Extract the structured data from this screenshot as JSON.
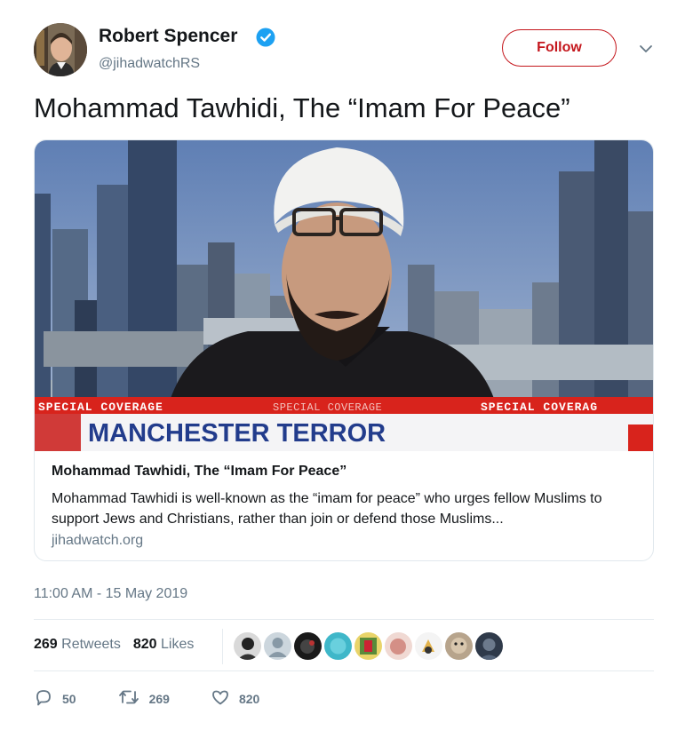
{
  "author": {
    "name": "Robert Spencer",
    "handle": "@jihadwatchRS",
    "verified": true
  },
  "follow_label": "Follow",
  "tweet_text": "Mohammad Tawhidi, The “Imam For Peace”",
  "card": {
    "title": "Mohammad Tawhidi, The “Imam For Peace”",
    "description": "Mohammad Tawhidi is well-known as the “imam for peace” who urges fellow Muslims to support Jews and Christians, rather than join or defend those Muslims...",
    "domain": "jihadwatch.org",
    "image": {
      "ticker_left": "SPECIAL COVERAGE",
      "ticker_mid": "SPECIAL COVERAGE",
      "ticker_right": "SPECIAL COVERAG",
      "headline": "MANCHESTER TERROR"
    }
  },
  "timestamp": "11:00 AM - 15 May 2019",
  "stats": {
    "retweets_count": "269",
    "retweets_label": "Retweets",
    "likes_count": "820",
    "likes_label": "Likes"
  },
  "actions": {
    "reply_count": "50",
    "retweet_count": "269",
    "like_count": "820"
  },
  "colors": {
    "follow": "#c4161c",
    "verified": "#1da1f2",
    "muted": "#657786",
    "ticker_red": "#d8231c",
    "headline_blue": "#223c8c"
  }
}
